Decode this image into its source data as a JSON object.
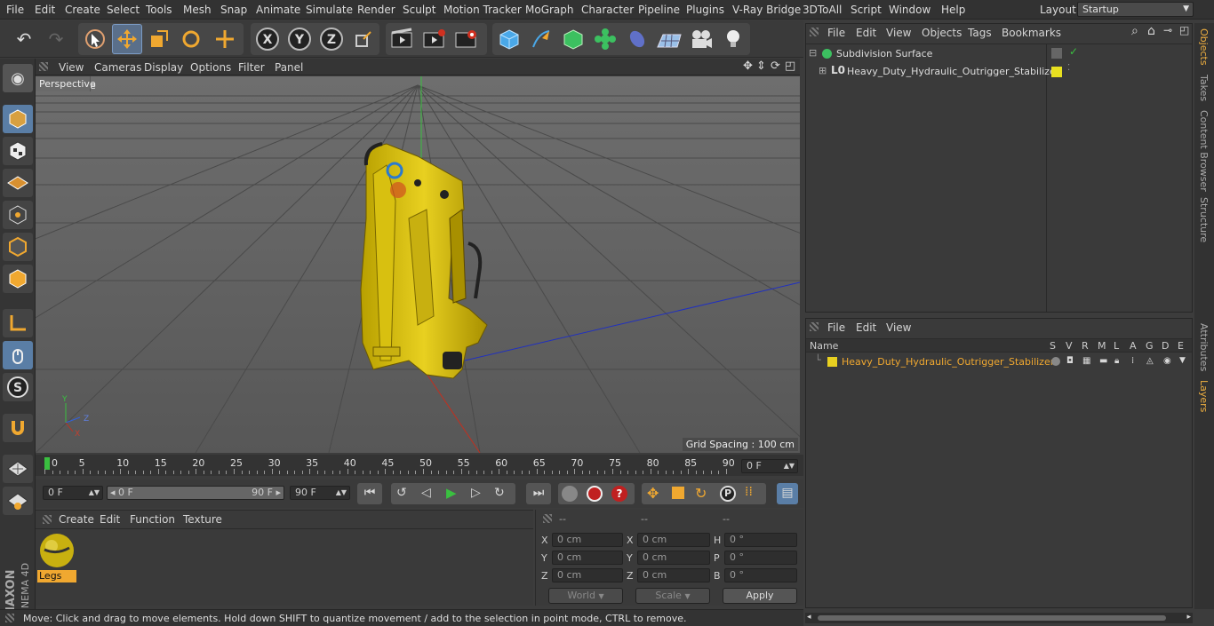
{
  "menu": [
    "File",
    "Edit",
    "Create",
    "Select",
    "Tools",
    "Mesh",
    "Snap",
    "Animate",
    "Simulate",
    "Render",
    "Sculpt",
    "Motion Tracker",
    "MoGraph",
    "Character",
    "Pipeline",
    "Plugins",
    "V-Ray Bridge",
    "3DToAll",
    "Script",
    "Window",
    "Help"
  ],
  "layout": {
    "label": "Layout:",
    "value": "Startup"
  },
  "viewport": {
    "menu": [
      "View",
      "Cameras",
      "Display",
      "Options",
      "Filter",
      "Panel"
    ],
    "camera_label": "Perspective",
    "grid_spacing": "Grid Spacing : 100 cm",
    "axis": {
      "x": "X",
      "y": "Y",
      "z": "Z"
    }
  },
  "timeline": {
    "ticks": [
      "0",
      "5",
      "10",
      "15",
      "20",
      "25",
      "30",
      "35",
      "40",
      "45",
      "50",
      "55",
      "60",
      "65",
      "70",
      "75",
      "80",
      "85",
      "90"
    ],
    "current_frame": "0 F"
  },
  "transport": {
    "start": "0 F",
    "range_start": "0 F",
    "range_end": "90 F",
    "end": "90 F"
  },
  "material_panel": {
    "menu": [
      "Create",
      "Edit",
      "Function",
      "Texture"
    ],
    "materials": [
      {
        "name": "Legs"
      }
    ]
  },
  "coords": {
    "headers": [
      "--",
      "--",
      "--"
    ],
    "rows": [
      {
        "a": "X",
        "av": "0 cm",
        "b": "X",
        "bv": "0 cm",
        "c": "H",
        "cv": "0 °"
      },
      {
        "a": "Y",
        "av": "0 cm",
        "b": "Y",
        "bv": "0 cm",
        "c": "P",
        "cv": "0 °"
      },
      {
        "a": "Z",
        "av": "0 cm",
        "b": "Z",
        "bv": "0 cm",
        "c": "B",
        "cv": "0 °"
      }
    ],
    "mode": "World",
    "scale": "Scale",
    "apply": "Apply"
  },
  "status": "Move: Click and drag to move elements. Hold down SHIFT to quantize movement / add to the selection in point mode, CTRL to remove.",
  "objects_panel": {
    "menu": [
      "File",
      "Edit",
      "View",
      "Objects",
      "Tags",
      "Bookmarks"
    ],
    "items": [
      {
        "name": "Subdivision Surface"
      },
      {
        "name": "Heavy_Duty_Hydraulic_Outrigger_Stabilizer"
      }
    ]
  },
  "layers_panel": {
    "menu": [
      "File",
      "Edit",
      "View"
    ],
    "columns": [
      "Name",
      "S",
      "V",
      "R",
      "M",
      "L",
      "A",
      "G",
      "D",
      "E"
    ],
    "items": [
      {
        "name": "Heavy_Duty_Hydraulic_Outrigger_Stabilizer",
        "color": "#e8d020"
      }
    ]
  },
  "side_tabs": [
    "Objects",
    "Takes",
    "Content Browser",
    "Structure",
    "Attributes",
    "Layers"
  ],
  "colors": {
    "accent": "#f0a830",
    "layer_yellow": "#e8d020",
    "object_yellow": "#e8e020"
  }
}
